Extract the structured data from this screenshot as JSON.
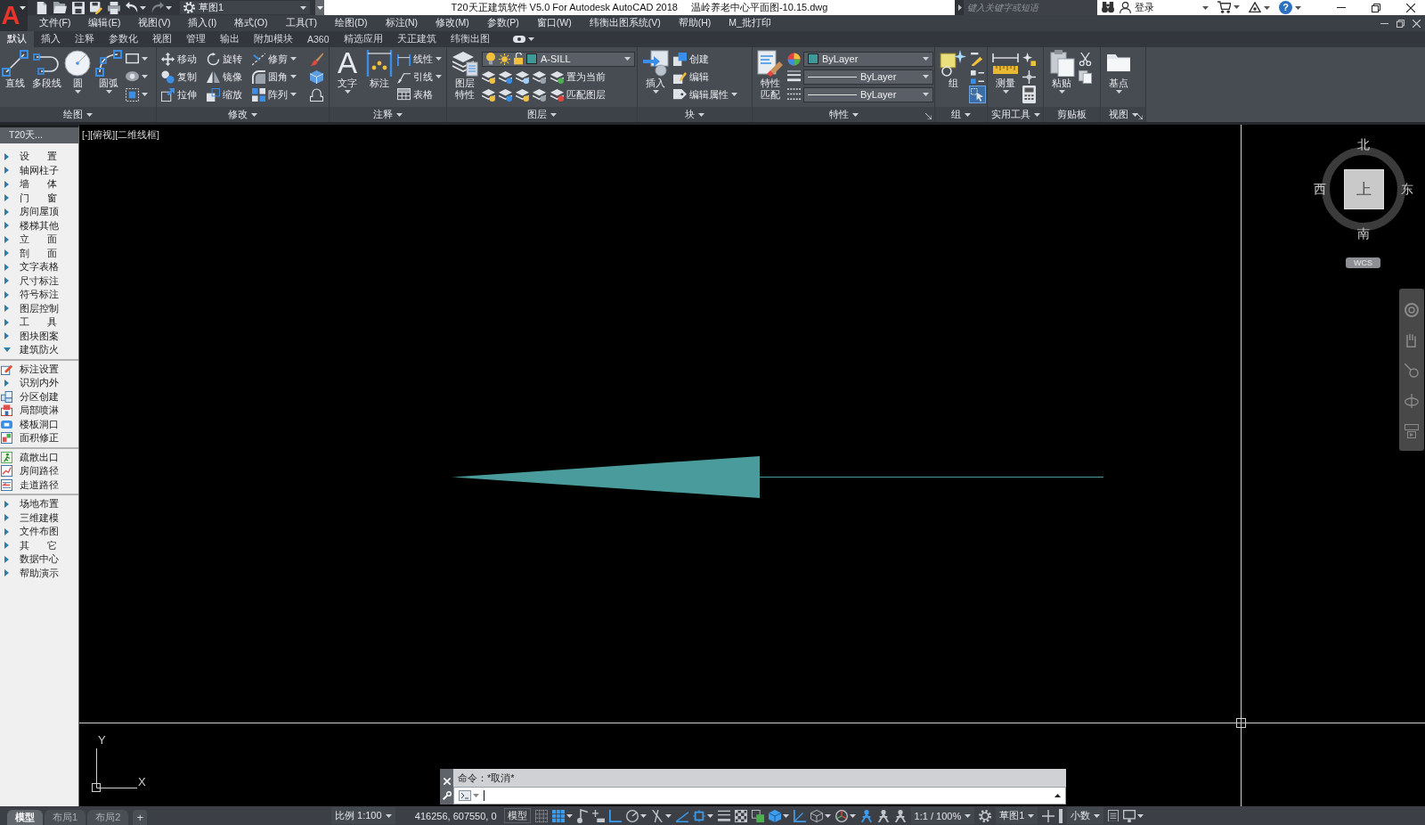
{
  "app": {
    "logo": "A"
  },
  "title_bar": {
    "workspace": "草图1",
    "title": "T20天正建筑软件 V5.0 For Autodesk AutoCAD 2018",
    "document": "温岭养老中心平面图-10.15.dwg",
    "search": {
      "placeholder": "键入关键字或短语"
    },
    "sign_in": "登录",
    "help": "?"
  },
  "menu_bar": {
    "items": [
      "文件(F)",
      "编辑(E)",
      "视图(V)",
      "插入(I)",
      "格式(O)",
      "工具(T)",
      "绘图(D)",
      "标注(N)",
      "修改(M)",
      "参数(P)",
      "窗口(W)",
      "纬衡出图系统(V)",
      "帮助(H)",
      "M_批打印"
    ]
  },
  "ribbon": {
    "tabs": [
      {
        "label": "默认",
        "selected": true
      },
      {
        "label": "插入",
        "selected": false
      },
      {
        "label": "注释",
        "selected": false
      },
      {
        "label": "参数化",
        "selected": false
      },
      {
        "label": "视图",
        "selected": false
      },
      {
        "label": "管理",
        "selected": false
      },
      {
        "label": "输出",
        "selected": false
      },
      {
        "label": "附加模块",
        "selected": false
      },
      {
        "label": "A360",
        "selected": false
      },
      {
        "label": "精选应用",
        "selected": false
      },
      {
        "label": "天正建筑",
        "selected": false
      },
      {
        "label": "纬衡出图",
        "selected": false
      }
    ],
    "panels": [
      {
        "title": "绘图",
        "menu": true,
        "launcher": false,
        "large": [
          {
            "label": "直线",
            "dropdown": false
          },
          {
            "label": "多段线",
            "dropdown": false
          },
          {
            "label": "圆",
            "dropdown": true
          },
          {
            "label": "圆弧",
            "dropdown": true
          }
        ],
        "rows": [
          [
            {
              "kind": "tool",
              "dropdown": true
            }
          ],
          [
            {
              "kind": "tool",
              "dropdown": true
            }
          ],
          [
            {
              "kind": "tool",
              "dropdown": true
            }
          ]
        ]
      },
      {
        "title": "修改",
        "menu": true,
        "launcher": false,
        "rows": [
          [
            {
              "kind": "tool",
              "label": "移动",
              "dropdown": false
            },
            {
              "kind": "tool",
              "label": "旋转",
              "dropdown": false
            },
            {
              "kind": "tool",
              "label": "修剪",
              "dropdown": true
            },
            {
              "kind": "tool",
              "dropdown": false
            }
          ],
          [
            {
              "kind": "tool",
              "label": "复制",
              "dropdown": false
            },
            {
              "kind": "tool",
              "label": "镜像",
              "dropdown": false
            },
            {
              "kind": "tool",
              "label": "圆角",
              "dropdown": true
            },
            {
              "kind": "tool",
              "dropdown": false
            }
          ],
          [
            {
              "kind": "tool",
              "label": "拉伸",
              "dropdown": false
            },
            {
              "kind": "tool",
              "label": "缩放",
              "dropdown": false
            },
            {
              "kind": "tool",
              "label": "阵列",
              "dropdown": true
            },
            {
              "kind": "tool",
              "dropdown": false
            }
          ]
        ]
      },
      {
        "title": "注释",
        "menu": true,
        "launcher": false,
        "large": [
          {
            "label": "文字",
            "glyph": "A",
            "dropdown": true
          },
          {
            "label": "标注",
            "dropdown": false
          }
        ],
        "rows": [
          [
            {
              "kind": "tool",
              "label": "线性",
              "dropdown": true
            }
          ],
          [
            {
              "kind": "tool",
              "label": "引线",
              "dropdown": true
            }
          ],
          [
            {
              "kind": "tool",
              "label": "表格",
              "dropdown": false
            }
          ]
        ]
      },
      {
        "title": "图层",
        "menu": true,
        "launcher": false,
        "large": [
          {
            "label": "图层特性",
            "dropdown": false
          }
        ],
        "rows": [
          [
            {
              "kind": "layer-select",
              "value": "A-SILL",
              "color": "#3f9a97",
              "on": true,
              "frozen": false,
              "locked": false
            }
          ],
          [
            {
              "kind": "tool",
              "dropdown": false
            },
            {
              "kind": "tool",
              "dropdown": false
            },
            {
              "kind": "tool",
              "dropdown": false
            },
            {
              "kind": "tool",
              "dropdown": false
            },
            {
              "kind": "tool",
              "label": "置为当前",
              "dropdown": false
            }
          ],
          [
            {
              "kind": "tool",
              "dropdown": false
            },
            {
              "kind": "tool",
              "dropdown": false
            },
            {
              "kind": "tool",
              "dropdown": false
            },
            {
              "kind": "tool",
              "dropdown": false
            },
            {
              "kind": "tool",
              "label": "匹配图层",
              "dropdown": false
            }
          ]
        ]
      },
      {
        "title": "块",
        "menu": true,
        "launcher": false,
        "large": [
          {
            "label": "插入",
            "dropdown": true
          }
        ],
        "rows": [
          [
            {
              "kind": "tool",
              "label": "创建",
              "dropdown": false
            }
          ],
          [
            {
              "kind": "tool",
              "label": "编辑",
              "dropdown": false
            }
          ],
          [
            {
              "kind": "tool",
              "label": "编辑属性",
              "dropdown": true
            }
          ]
        ]
      },
      {
        "title": "特性",
        "menu": true,
        "launcher": true,
        "large": [
          {
            "label": "特性匹配",
            "dropdown": false
          }
        ],
        "rows": [
          [
            {
              "kind": "tool",
              "dropdown": false
            },
            {
              "kind": "color-select",
              "value": "ByLayer",
              "color": "#3f9a97"
            }
          ],
          [
            {
              "kind": "tool",
              "dropdown": false
            },
            {
              "kind": "line-select",
              "value": "ByLayer"
            }
          ],
          [
            {
              "kind": "tool",
              "dropdown": false
            },
            {
              "kind": "line-select",
              "value": "ByLayer"
            }
          ]
        ]
      },
      {
        "title": "组",
        "menu": true,
        "launcher": false,
        "large": [
          {
            "label": "组",
            "dropdown": false
          }
        ],
        "rows": [
          [
            {
              "kind": "tool",
              "dropdown": false,
              "on": false
            }
          ],
          [
            {
              "kind": "tool",
              "dropdown": false,
              "on": false
            }
          ],
          [
            {
              "kind": "tool",
              "dropdown": false,
              "on": true
            }
          ]
        ]
      },
      {
        "title": "实用工具",
        "menu": true,
        "launcher": false,
        "large": [
          {
            "label": "测量",
            "dropdown": true
          }
        ],
        "rows": [
          [
            {
              "kind": "tool",
              "dropdown": false
            }
          ],
          [
            {
              "kind": "tool",
              "dropdown": false
            }
          ],
          [
            {
              "kind": "tool",
              "dropdown": false
            }
          ]
        ]
      },
      {
        "title": "剪贴板",
        "menu": false,
        "launcher": false,
        "large": [
          {
            "label": "粘贴",
            "dropdown": true
          }
        ],
        "rows": [
          [
            {
              "kind": "tool",
              "dropdown": false
            }
          ],
          [
            {
              "kind": "tool",
              "dropdown": false
            }
          ]
        ]
      },
      {
        "title": "视图",
        "menu": true,
        "launcher": true,
        "large": [
          {
            "label": "基点",
            "dropdown": true
          }
        ]
      }
    ]
  },
  "sidebar": {
    "title": "T20天...",
    "items": [
      {
        "label": "设 置",
        "expanded": false
      },
      {
        "label": "轴网柱子",
        "expanded": false
      },
      {
        "label": "墙 体",
        "expanded": false
      },
      {
        "label": "门 窗",
        "expanded": false
      },
      {
        "label": "房间屋顶",
        "expanded": false
      },
      {
        "label": "楼梯其他",
        "expanded": false
      },
      {
        "label": "立 面",
        "expanded": false
      },
      {
        "label": "剖 面",
        "expanded": false
      },
      {
        "label": "文字表格",
        "expanded": false
      },
      {
        "label": "尺寸标注",
        "expanded": false
      },
      {
        "label": "符号标注",
        "expanded": false
      },
      {
        "label": "图层控制",
        "expanded": false
      },
      {
        "label": "工 具",
        "expanded": false
      },
      {
        "label": "图块图案",
        "expanded": false
      },
      {
        "label": "建筑防火",
        "expanded": true,
        "children": [
          {
            "kind": "separator"
          },
          {
            "kind": "command",
            "label": "标注设置"
          },
          {
            "kind": "folder",
            "label": "识别内外",
            "expanded": false
          },
          {
            "kind": "command",
            "label": "分区创建"
          },
          {
            "kind": "command",
            "label": "局部喷淋"
          },
          {
            "kind": "command",
            "label": "楼板洞口"
          },
          {
            "kind": "command",
            "label": "面积修正"
          },
          {
            "kind": "separator"
          },
          {
            "kind": "command",
            "label": "疏散出口"
          },
          {
            "kind": "command",
            "label": "房间路径"
          },
          {
            "kind": "command",
            "label": "走道路径"
          },
          {
            "kind": "separator"
          }
        ]
      },
      {
        "label": "场地布置",
        "expanded": false
      },
      {
        "label": "三维建模",
        "expanded": false
      },
      {
        "label": "文件布图",
        "expanded": false
      },
      {
        "label": "其 它",
        "expanded": false
      },
      {
        "label": "数据中心",
        "expanded": false
      },
      {
        "label": "帮助演示",
        "expanded": false
      }
    ]
  },
  "viewport": {
    "controls": [
      "[-]",
      "[俯视]",
      "[二维线框]"
    ],
    "viewcube": {
      "north": "北",
      "east": "东",
      "south": "南",
      "west": "西",
      "face": "上",
      "ucs": "WCS"
    },
    "ucs_icon": {
      "y_axis": "Y",
      "x_axis": "X"
    }
  },
  "command_line": {
    "history": "命令：*取消*"
  },
  "status_bar": {
    "layout_tabs": [
      {
        "label": "模型",
        "selected": true
      },
      {
        "label": "布局1",
        "selected": false
      },
      {
        "label": "布局2",
        "selected": false
      }
    ],
    "new_tab": "+",
    "items": [
      {
        "kind": "text",
        "label": "比例 1:100",
        "dropdown": true
      },
      {
        "kind": "readout",
        "label": "416256, 607550, 0"
      },
      {
        "kind": "button",
        "label": "模型"
      },
      {
        "kind": "icon",
        "on": false,
        "dropdown": false
      },
      {
        "kind": "icon",
        "on": true,
        "dropdown": true
      },
      {
        "kind": "icon",
        "on": false,
        "dropdown": false
      },
      {
        "kind": "icon",
        "on": false,
        "dropdown": false
      },
      {
        "kind": "icon",
        "on": true,
        "dropdown": false
      },
      {
        "kind": "icon",
        "on": false,
        "dropdown": true
      },
      {
        "kind": "icon",
        "on": false,
        "dropdown": true
      },
      {
        "kind": "icon",
        "on": true,
        "dropdown": false
      },
      {
        "kind": "icon",
        "on": true,
        "dropdown": true
      },
      {
        "kind": "icon",
        "on": false,
        "dropdown": false
      },
      {
        "kind": "icon",
        "on": false,
        "dropdown": false
      },
      {
        "kind": "icon",
        "on": false,
        "dropdown": false
      },
      {
        "kind": "icon",
        "on": true,
        "dropdown": true
      },
      {
        "kind": "icon",
        "on": true,
        "dropdown": false
      },
      {
        "kind": "icon",
        "on": false,
        "dropdown": true
      },
      {
        "kind": "icon",
        "on": false,
        "dropdown": true
      },
      {
        "kind": "icon",
        "on": true,
        "dropdown": false
      },
      {
        "kind": "icon",
        "on": false,
        "dropdown": false
      },
      {
        "kind": "icon",
        "on": false,
        "dropdown": false
      },
      {
        "kind": "text",
        "label": "1:1 / 100%",
        "dropdown": true
      },
      {
        "kind": "icon",
        "on": false,
        "dropdown": false
      },
      {
        "kind": "text",
        "label": "草图1",
        "dropdown": true
      },
      {
        "kind": "icon",
        "on": false,
        "dropdown": false
      },
      {
        "kind": "icon",
        "on": false,
        "dropdown": false
      },
      {
        "kind": "text",
        "label": "小数",
        "dropdown": true
      },
      {
        "kind": "icon",
        "on": false,
        "dropdown": false
      },
      {
        "kind": "icon",
        "on": false,
        "dropdown": true
      }
    ]
  }
}
